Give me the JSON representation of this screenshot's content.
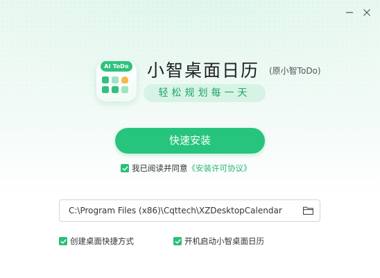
{
  "app": {
    "title": "小智桌面日历",
    "subtitle": "(原小智ToDo)",
    "slogan": "轻松规划每一天",
    "logo_tag": "AI ToDo"
  },
  "window_controls": {
    "minimize_icon": "minimize-icon",
    "close_icon": "close-icon"
  },
  "install": {
    "button_label": "快速安装"
  },
  "agreement": {
    "checked": true,
    "prefix": "我已阅读并同意",
    "link": "《安装许可协议》"
  },
  "install_path": {
    "value": "C:\\Program Files (x86)\\Cqttech\\XZDesktopCalendar",
    "browse_icon": "folder-icon"
  },
  "options": [
    {
      "label": "创建桌面快捷方式",
      "checked": true
    },
    {
      "label": "开机启动小智桌面日历",
      "checked": true
    }
  ],
  "colors": {
    "accent": "#26c47d",
    "link": "#2bb574",
    "slogan_bg": "#d7f3e6"
  }
}
